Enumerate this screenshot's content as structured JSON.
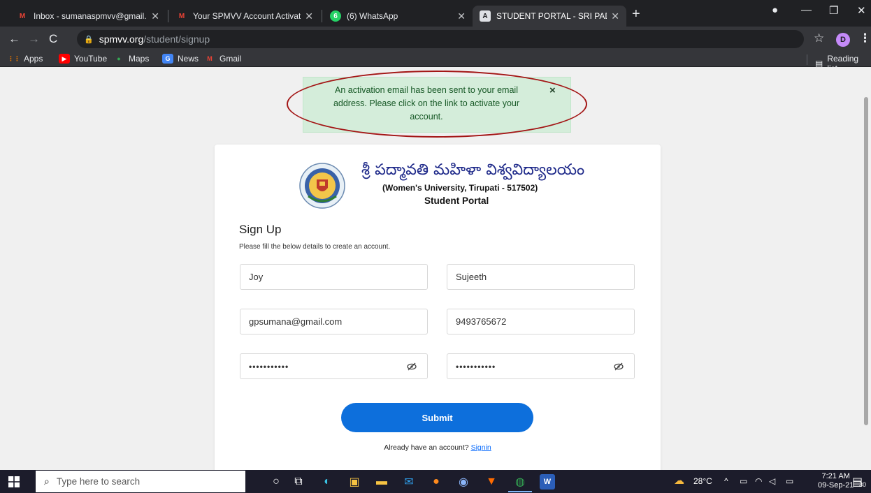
{
  "browser": {
    "tabs": [
      {
        "label": "Inbox - sumanaspmvv@gmail.co",
        "icon": "gmail-icon"
      },
      {
        "label": "Your SPMVV Account Activation",
        "icon": "gmail-icon"
      },
      {
        "label": "(6) WhatsApp",
        "icon": "whatsapp-icon"
      },
      {
        "label": "STUDENT PORTAL - SRI PADMAV",
        "icon": "portal-icon",
        "active": true
      }
    ],
    "url_host": "spmvv.org",
    "url_path": "/student/signup",
    "profile_initial": "D",
    "bookmarks": [
      "Apps",
      "YouTube",
      "Maps",
      "News",
      "Gmail"
    ],
    "reading_list": "Reading list"
  },
  "alert": {
    "message": "An activation email has been sent to your email address. Please click on the link to activate your account.",
    "close_label": "×"
  },
  "university": {
    "name_telugu": "శ్రీ పద్మావతి మహిళా విశ్వవిద్యాలయం",
    "subtitle": "(Women's University, Tirupati - 517502)",
    "portal": "Student Portal"
  },
  "form": {
    "title": "Sign Up",
    "subtitle": "Please fill the below details to create an account.",
    "first_name": "Joy",
    "last_name": "Sujeeth",
    "email": "gpsumana@gmail.com",
    "phone": "9493765672",
    "password": "•••••••••••",
    "confirm_password": "•••••••••••",
    "submit_label": "Submit",
    "already_text": "Already have an account?",
    "signin_label": "Signin"
  },
  "taskbar": {
    "search_placeholder": "Type here to search",
    "temperature": "28°C",
    "time": "7:21 AM",
    "date": "09-Sep-21",
    "notification_count": "30"
  },
  "colors": {
    "accent": "#0d6fdc",
    "alert_bg": "#d4edda",
    "alert_text": "#155724",
    "annotation": "#a31515"
  }
}
